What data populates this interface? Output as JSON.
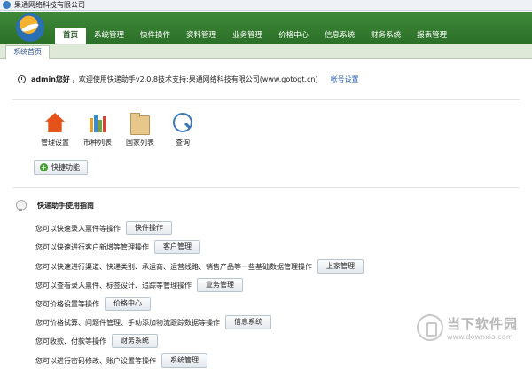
{
  "window": {
    "title": "果通网络科技有限公司"
  },
  "menu": [
    {
      "label": "首页",
      "active": true
    },
    {
      "label": "系统管理"
    },
    {
      "label": "快件操作"
    },
    {
      "label": "资料管理"
    },
    {
      "label": "业务管理"
    },
    {
      "label": "价格中心"
    },
    {
      "label": "信息系统"
    },
    {
      "label": "财务系统"
    },
    {
      "label": "报表管理"
    }
  ],
  "tabs": {
    "current": "系统首页"
  },
  "welcome": {
    "user": "admin您好",
    "message": "，欢迎使用快递助手v2.0.8技术支持:果通网络科技有限公司(www.gotogt.cn)",
    "account_link": "帐号设置"
  },
  "quick_icons": [
    {
      "label": "管理设置",
      "icon": "house-icon"
    },
    {
      "label": "币种列表",
      "icon": "books-icon"
    },
    {
      "label": "国家列表",
      "icon": "folder-icon"
    },
    {
      "label": "查询",
      "icon": "magnifier-icon"
    }
  ],
  "quick_button": "快捷功能",
  "guide": {
    "title": "快递助手使用指南",
    "rows": [
      {
        "text": "您可以快速录入票件等操作",
        "button": "快件操作"
      },
      {
        "text": "您可以快速进行客户新增等管理操作",
        "button": "客户管理"
      },
      {
        "text": "您可以快速进行渠道、快递类别、承运商、运营线路、销售产品等一些基础数据管理操作",
        "button": "上家管理"
      },
      {
        "text": "您可以查看录入票件、标签设计、追踪等管理操作",
        "button": "业务管理"
      },
      {
        "text": "您可价格设置等操作",
        "button": "价格中心"
      },
      {
        "text": "您可价格试算、问题件管理、手动添加物流跟踪数据等操作",
        "button": "信息系统"
      },
      {
        "text": "您可收款、付款等操作",
        "button": "财务系统"
      },
      {
        "text": "您可以进行密码修改、账户设置等操作",
        "button": "系统管理"
      }
    ]
  },
  "watermark": {
    "name": "当下软件园",
    "url": "www.downxia.com"
  }
}
